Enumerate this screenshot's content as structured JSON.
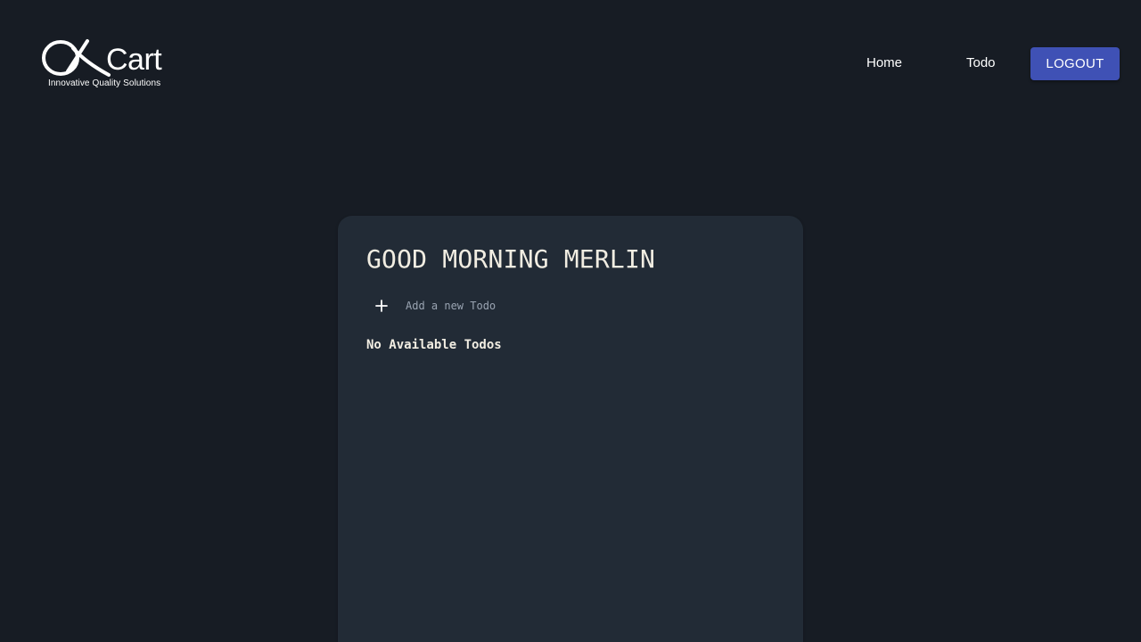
{
  "header": {
    "logo": {
      "wordmark": "Cart",
      "tagline": "Innovative Quality Solutions"
    },
    "nav": {
      "home_label": "Home",
      "todo_label": "Todo",
      "logout_label": "LOGOUT"
    }
  },
  "todo_card": {
    "greeting": "GOOD MORNING MERLIN",
    "add_todo": {
      "icon": "plus-icon",
      "placeholder": "Add a new Todo",
      "value": ""
    },
    "empty_message": "No Available Todos"
  },
  "colors": {
    "background": "#171c24",
    "card": "#222b36",
    "accent": "#3f51b5",
    "text": "#ffffff",
    "heading": "#f1ede2",
    "placeholder": "#9aa4b2"
  }
}
